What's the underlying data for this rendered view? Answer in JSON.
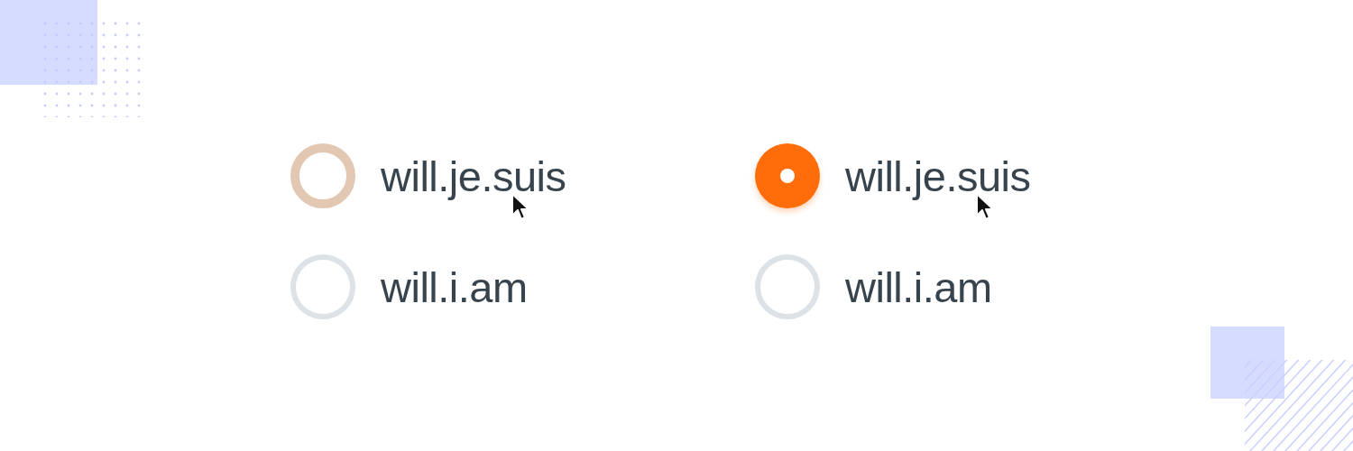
{
  "groups": [
    {
      "options": [
        {
          "label": "will.je.suis",
          "selected": false,
          "hovered": true,
          "pointer": true
        },
        {
          "label": "will.i.am",
          "selected": false,
          "hovered": false,
          "pointer": false
        }
      ]
    },
    {
      "options": [
        {
          "label": "will.je.suis",
          "selected": true,
          "hovered": false,
          "pointer": true
        },
        {
          "label": "will.i.am",
          "selected": false,
          "hovered": false,
          "pointer": false
        }
      ]
    }
  ]
}
